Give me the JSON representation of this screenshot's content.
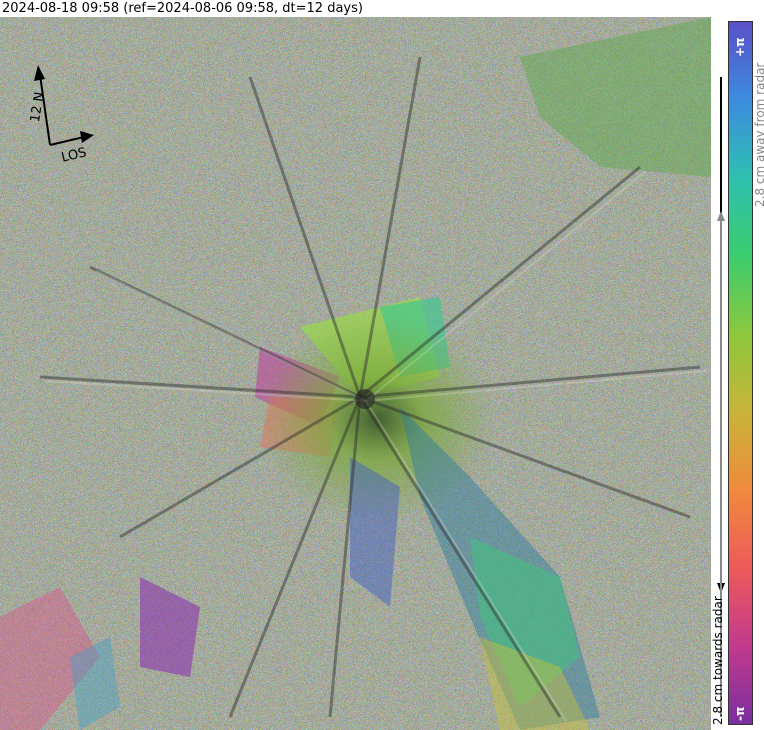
{
  "title": "2024-08-18 09:58 (ref=2024-08-06 09:58, dt=12 days)",
  "compass": {
    "north_label": "12 N",
    "los_label": "LOS"
  },
  "colorbar": {
    "top_tick": "+π",
    "bottom_tick": "-π",
    "away_label": "2.8 cm away from radar",
    "towards_label": "2.8 cm towards radar",
    "colors": [
      "#7a2fa0",
      "#c23a8c",
      "#ee5a5a",
      "#f08a3c",
      "#c8b43a",
      "#8cc83c",
      "#3ccc6e",
      "#2ec0b0",
      "#3c8ce0",
      "#5a50c8"
    ]
  }
}
